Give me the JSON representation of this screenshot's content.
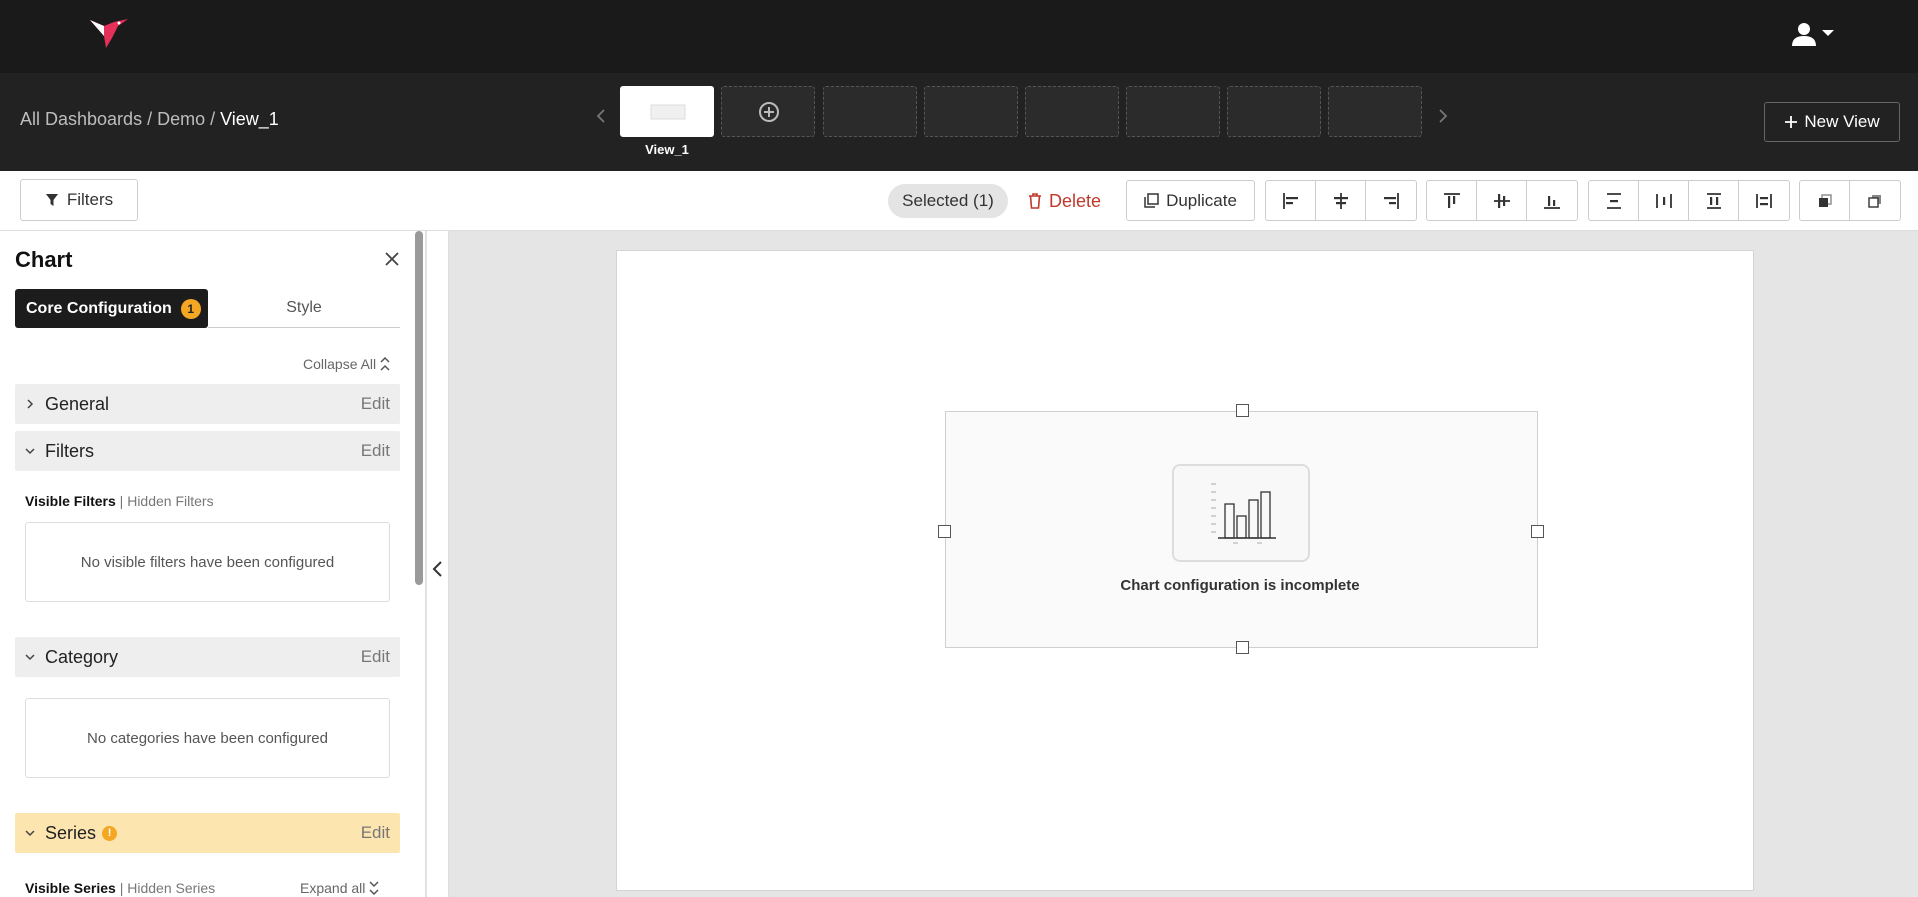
{
  "breadcrumb": {
    "root": "All Dashboards",
    "mid": "Demo",
    "current": "View_1",
    "sep": "/"
  },
  "views": {
    "active_label": "View_1"
  },
  "header": {
    "new_view_label": "New View"
  },
  "toolbar": {
    "filters_label": "Filters",
    "selected_label": "Selected (1)",
    "delete_label": "Delete",
    "duplicate_label": "Duplicate"
  },
  "panel": {
    "title": "Chart",
    "tabs": {
      "core": "Core Configuration",
      "core_badge": "1",
      "style": "Style"
    },
    "collapse_all": "Collapse All",
    "sections": {
      "general": {
        "name": "General",
        "edit": "Edit"
      },
      "filters": {
        "name": "Filters",
        "edit": "Edit"
      },
      "category": {
        "name": "Category",
        "edit": "Edit"
      },
      "series": {
        "name": "Series",
        "edit": "Edit",
        "badge": "!"
      }
    },
    "filters_tabs": {
      "visible": "Visible Filters",
      "hidden": "Hidden Filters",
      "sep": "|"
    },
    "no_filters": "No visible filters have been configured",
    "no_categories": "No categories have been configured",
    "series_tabs": {
      "visible": "Visible Series",
      "hidden": "Hidden Series",
      "sep": "|"
    },
    "expand_all": "Expand all"
  },
  "chart": {
    "message": "Chart configuration is incomplete"
  },
  "colors": {
    "topbar": "#1a1a1a",
    "accent_warning": "#f5a623",
    "danger": "#c0392b",
    "logo": "#e5305a"
  }
}
